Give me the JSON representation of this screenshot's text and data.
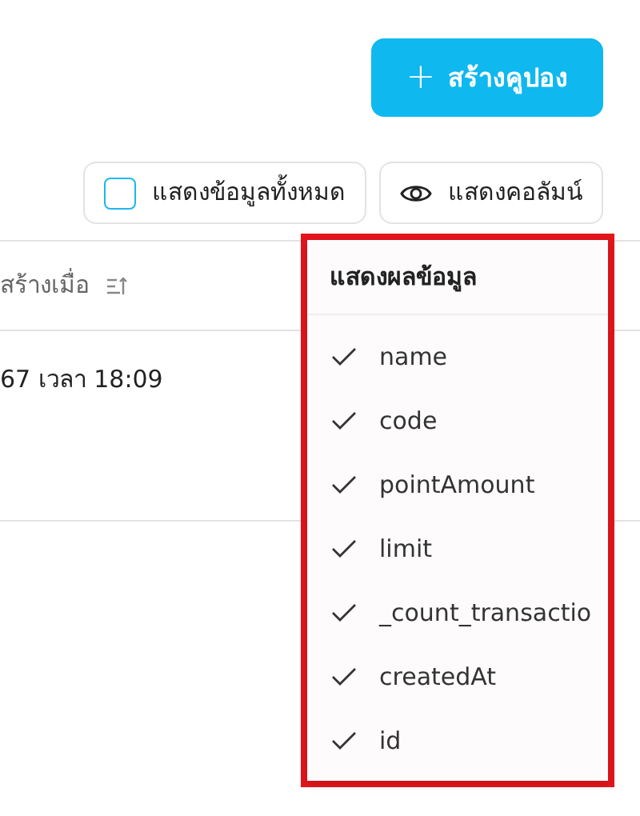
{
  "create_button": {
    "icon": "+",
    "label": "สร้างคูปอง"
  },
  "toolbar": {
    "show_all": {
      "label": "แสดงข้อมูลทั้งหมด",
      "checked": false
    },
    "columns_button": {
      "label": "แสดงคอลัมน์"
    }
  },
  "table": {
    "columns": [
      {
        "label": "สร้างเมื่อ"
      }
    ],
    "rows": [
      [
        "67 เวลา 18:09"
      ]
    ]
  },
  "column_menu": {
    "title": "แสดงผลข้อมูล",
    "items": [
      {
        "label": "name",
        "checked": true
      },
      {
        "label": "code",
        "checked": true
      },
      {
        "label": "pointAmount",
        "checked": true
      },
      {
        "label": "limit",
        "checked": true
      },
      {
        "label": "_count_transactio",
        "checked": true
      },
      {
        "label": "createdAt",
        "checked": true
      },
      {
        "label": "id",
        "checked": true
      }
    ]
  }
}
